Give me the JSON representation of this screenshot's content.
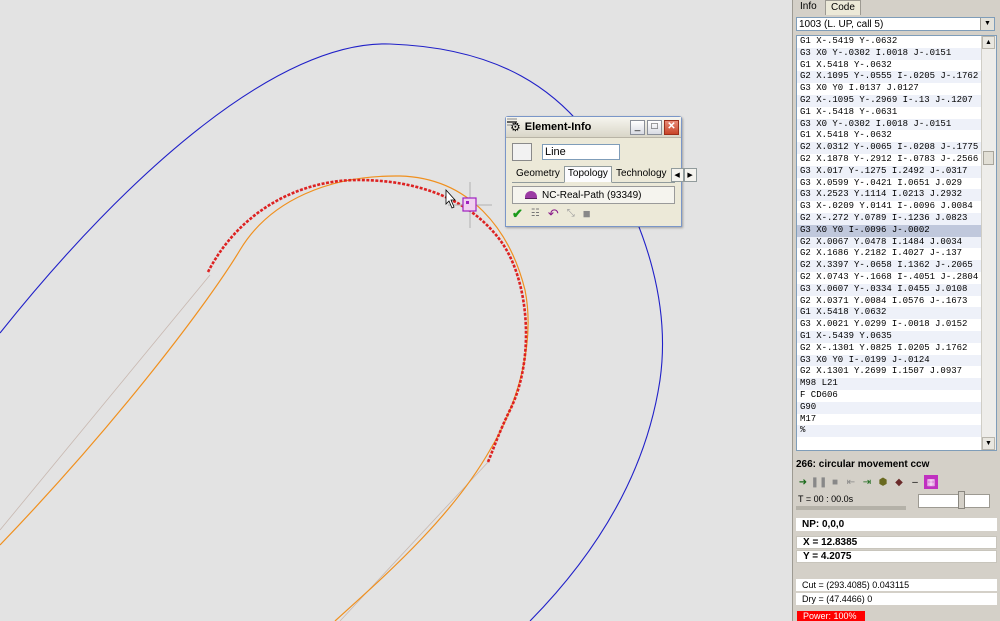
{
  "element_info": {
    "title": "Element-Info",
    "element_type": "Line",
    "tabs": [
      "Geometry",
      "Topology",
      "Technology"
    ],
    "active_tab": "Topology",
    "path_label": "NC-Real-Path (93349)"
  },
  "panel": {
    "tabs": [
      "Info",
      "Code"
    ],
    "active_tab": "Code",
    "program": "1003 (L. UP, call 5)",
    "selected_index": 16,
    "code_lines": [
      "G1 X-.5419 Y-.0632",
      "G3 X0 Y-.0302 I.0018 J-.0151",
      "G1 X.5418 Y-.0632",
      "G2 X.1095 Y-.0555 I-.0205 J-.1762",
      "G3 X0 Y0 I.0137 J.0127",
      "G2 X-.1095 Y-.2969 I-.13 J-.1207",
      "G1 X-.5418 Y-.0631",
      "G3 X0 Y-.0302 I.0018 J-.0151",
      "G1 X.5418 Y-.0632",
      "G2 X.0312 Y-.0065 I-.0208 J-.1775",
      "G2 X.1878 Y-.2912 I-.0783 J-.2566",
      "G3 X.017 Y-.1275 I.2492 J-.0317",
      "G3 X.0599 Y-.0421 I.0651 J.029",
      "G3 X.2523 Y.1114 I.0213 J.2932",
      "G3 X-.0209 Y.0141 I-.0096 J.0084",
      "G2 X-.272 Y.0789 I-.1236 J.0823",
      "G3 X0 Y0 I-.0096 J-.0002",
      "G2 X.0067 Y.0478 I.1484 J.0034",
      "G2 X.1686 Y.2182 I.4027 J-.137",
      "G2 X.3397 Y-.0658 I.1362 J-.2065",
      "G2 X.0743 Y-.1668 I-.4051 J-.2804",
      "G3 X.0607 Y-.0334 I.0455 J.0108",
      "G2 X.0371 Y.0084 I.0576 J-.1673",
      "G1 X.5418 Y.0632",
      "G3 X.0021 Y.0299 I-.0018 J.0152",
      "G1 X-.5439 Y.0635",
      "G2 X-.1301 Y.0825 I.0205 J.1762",
      "G3 X0 Y0 I-.0199 J-.0124",
      "G2 X.1301 Y.2699 I.1507 J.0937",
      "M98 L21",
      "F CD606",
      "G90",
      "M17",
      "%"
    ],
    "status_line": "266:  circular movement ccw",
    "time": "T = 00 : 00.0s",
    "np": "NP: 0,0,0",
    "x": "X = 12.8385",
    "y": "Y = 4.2075",
    "cut": "Cut = (293.4085)  0.043115",
    "dry": "Dry = (47.4466)  0",
    "power": "Power: 100%"
  },
  "colors": {
    "canvas_bg": "#e3e3e3",
    "contour": "#2020c8",
    "toolpath": "#f0901e",
    "highlight": "#dd2222",
    "selection": "#c0c8dc"
  }
}
